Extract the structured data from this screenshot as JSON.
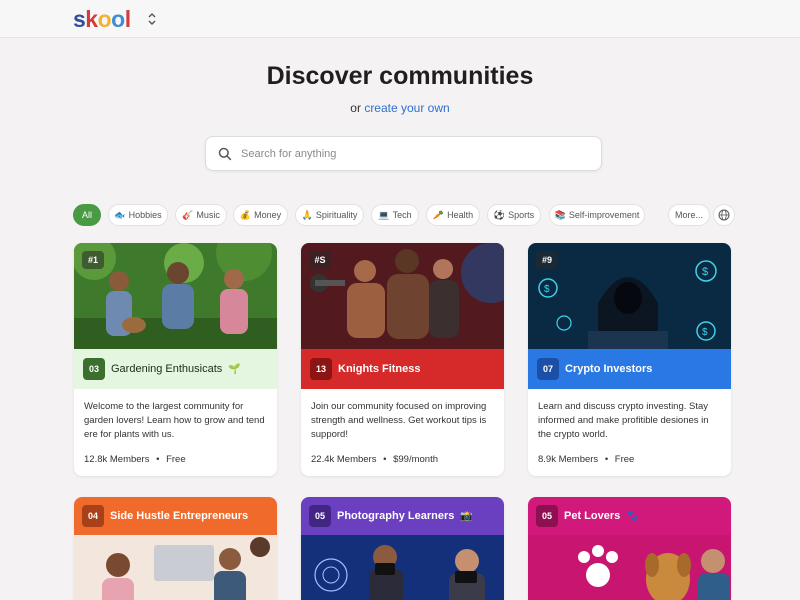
{
  "header": {
    "logo_letters": [
      "s",
      "k",
      "o",
      "o",
      "l"
    ],
    "logo_colors": [
      "#2e4f9c",
      "#d23d3a",
      "#f2b233",
      "#3f8dd8",
      "#d23d3a"
    ]
  },
  "hero": {
    "title": "Discover communities",
    "subtitle_prefix": "or",
    "create_link": "create your own"
  },
  "search": {
    "placeholder": "Search for anything",
    "icon": "search-icon"
  },
  "categories": [
    {
      "label": "All",
      "icon": "",
      "active": true
    },
    {
      "label": "Hobbies",
      "icon": "🐟",
      "active": false
    },
    {
      "label": "Music",
      "icon": "🎸",
      "active": false
    },
    {
      "label": "Money",
      "icon": "💰",
      "active": false
    },
    {
      "label": "Spirituality",
      "icon": "🙏",
      "active": false
    },
    {
      "label": "Tech",
      "icon": "💻",
      "active": false
    },
    {
      "label": "Health",
      "icon": "🥕",
      "active": false
    },
    {
      "label": "Sports",
      "icon": "⚽",
      "active": false
    },
    {
      "label": "Self-improvement",
      "icon": "📚",
      "active": false
    },
    {
      "label": "More...",
      "icon": "",
      "active": false
    }
  ],
  "cards": [
    {
      "rank": "#1",
      "badge": "03",
      "name": "Gardening Enthusicats",
      "name_icon": "🌱",
      "band_color": "#e4f5e0",
      "badge_color": "#3a6f2e",
      "name_color": "#1f2a1c",
      "description": "Welcome to the largest community for garden lovers! Learn how to grow and tend ere for plants with us.",
      "members": "12.8k Members",
      "price": "Free"
    },
    {
      "rank": "#S",
      "badge": "13",
      "name": "Knights Fitness",
      "name_icon": "",
      "band_color": "#d62a2a",
      "badge_color": "#8c1414",
      "name_color": "#ffffff",
      "description": "Join our community focused on improving strength and wellness. Get workout tips is suppord!",
      "members": "22.4k Members",
      "price": "$99/month"
    },
    {
      "rank": "#9",
      "badge": "07",
      "name": "Crypto Investors",
      "name_icon": "",
      "band_color": "#2a78e4",
      "badge_color": "#1c4fa6",
      "name_color": "#ffffff",
      "description": "Learn and discuss crypto investing. Stay informed and make profitible desiones in the crypto world.",
      "members": "8.9k Members",
      "price": "Free"
    }
  ],
  "cards_row2": [
    {
      "badge": "04",
      "name": "Side Hustle Entrepreneurs",
      "name_icon": "",
      "band_color": "#f06a2c",
      "badge_color": "#a8401a"
    },
    {
      "badge": "05",
      "name": "Photography Learners",
      "name_icon": "📸",
      "band_color": "#6a3fc0",
      "badge_color": "#432583"
    },
    {
      "badge": "05",
      "name": "Pet Lovers",
      "name_icon": "🐾",
      "band_color": "#d0197a",
      "badge_color": "#8e0f52"
    }
  ],
  "separator": "•"
}
